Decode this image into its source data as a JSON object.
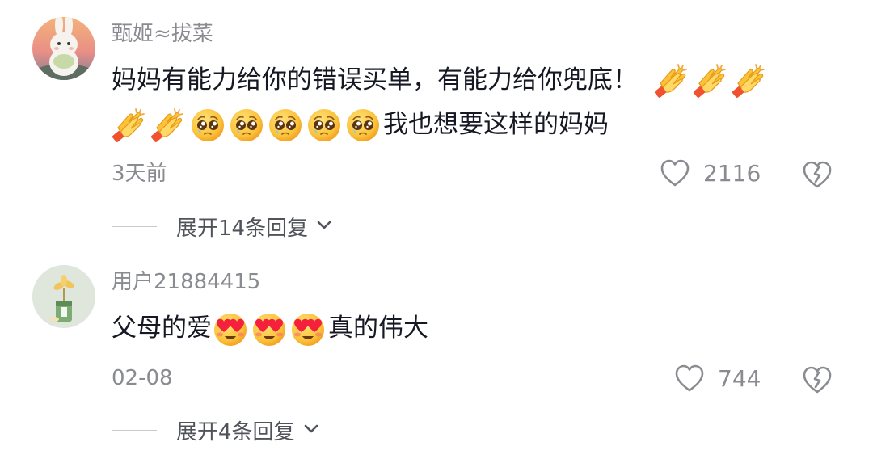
{
  "comments": [
    {
      "username": "甄姬≈拔菜",
      "text_line1": "妈妈有能力给你的错误买单，有能力给你兜底！",
      "text_line2_suffix": "我也想要这样的妈妈",
      "emoji_line1": [
        "clapping-hands",
        "clapping-hands",
        "clapping-hands"
      ],
      "emoji_line2": [
        "clapping-hands",
        "clapping-hands",
        "pleading-face",
        "pleading-face",
        "pleading-face",
        "pleading-face",
        "pleading-face"
      ],
      "time": "3天前",
      "likes": "2116",
      "expand_label": "展开14条回复"
    },
    {
      "username": "用户21884415",
      "text_prefix": "父母的爱",
      "emoji_inline": [
        "heart-eyes-face",
        "heart-eyes-face",
        "heart-eyes-face"
      ],
      "text_suffix": "真的伟大",
      "time": "02-08",
      "likes": "744",
      "expand_label": "展开4条回复"
    }
  ],
  "colors": {
    "text_primary": "#161823",
    "text_secondary": "#8a8b91",
    "expand_text": "#51535a"
  }
}
